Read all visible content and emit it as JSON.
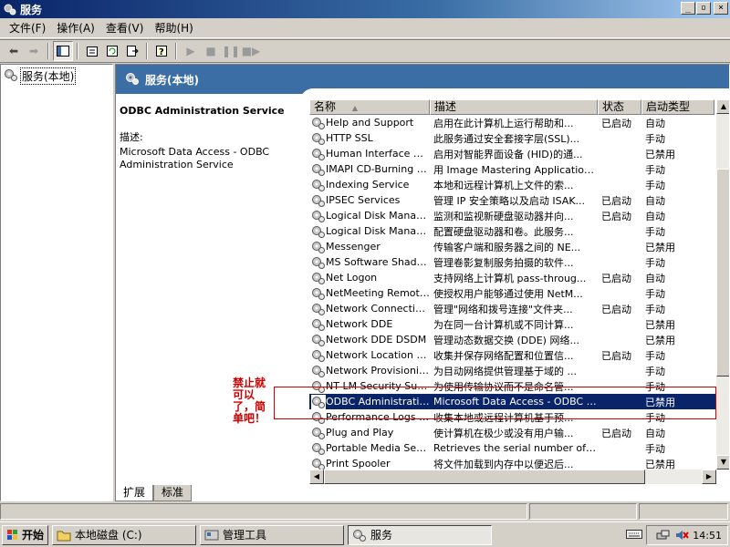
{
  "window": {
    "title": "服务"
  },
  "menu": [
    "文件(F)",
    "操作(A)",
    "查看(V)",
    "帮助(H)"
  ],
  "tree": {
    "root": "服务(本地)"
  },
  "pane": {
    "header": "服务(本地)",
    "selected_service": "ODBC Administration Service",
    "desc_label": "描述:",
    "desc_text": "Microsoft Data Access - ODBC Administration Service"
  },
  "table": {
    "columns": [
      "名称",
      "描述",
      "状态",
      "启动类型"
    ],
    "sort_arrow": "▲",
    "rows": [
      {
        "name": "Help and Support",
        "desc": "启用在此计算机上运行帮助和...",
        "status": "已启动",
        "type": "自动"
      },
      {
        "name": "HTTP SSL",
        "desc": "此服务通过安全套接字层(SSL)...",
        "status": "",
        "type": "手动"
      },
      {
        "name": "Human Interface D...",
        "desc": "启用对智能界面设备 (HID)的通...",
        "status": "",
        "type": "已禁用"
      },
      {
        "name": "IMAPI CD-Burning C...",
        "desc": "用 Image Mastering Applications ...",
        "status": "",
        "type": "手动"
      },
      {
        "name": "Indexing Service",
        "desc": "本地和远程计算机上文件的索...",
        "status": "",
        "type": "手动"
      },
      {
        "name": "IPSEC Services",
        "desc": "管理 IP 安全策略以及启动 ISAK...",
        "status": "已启动",
        "type": "自动"
      },
      {
        "name": "Logical Disk Manager",
        "desc": "监测和监视新硬盘驱动器并向...",
        "status": "已启动",
        "type": "自动"
      },
      {
        "name": "Logical Disk Manage...",
        "desc": "配置硬盘驱动器和卷。此服务...",
        "status": "",
        "type": "手动"
      },
      {
        "name": "Messenger",
        "desc": "传输客户端和服务器之间的 NE...",
        "status": "",
        "type": "已禁用"
      },
      {
        "name": "MS Software Shado...",
        "desc": "管理卷影复制服务拍摄的软件...",
        "status": "",
        "type": "手动"
      },
      {
        "name": "Net Logon",
        "desc": "支持网络上计算机 pass-throug...",
        "status": "已启动",
        "type": "自动"
      },
      {
        "name": "NetMeeting Remote...",
        "desc": "使授权用户能够通过使用 NetM...",
        "status": "",
        "type": "手动"
      },
      {
        "name": "Network Connections",
        "desc": "管理\"网络和拨号连接\"文件夹...",
        "status": "已启动",
        "type": "手动"
      },
      {
        "name": "Network DDE",
        "desc": "为在同一台计算机或不同计算...",
        "status": "",
        "type": "已禁用"
      },
      {
        "name": "Network DDE DSDM",
        "desc": "管理动态数据交换 (DDE) 网络...",
        "status": "",
        "type": "已禁用"
      },
      {
        "name": "Network Location A...",
        "desc": "收集并保存网络配置和位置信...",
        "status": "已启动",
        "type": "手动"
      },
      {
        "name": "Network Provisionin...",
        "desc": "为目动网络提供管理基于域的 ...",
        "status": "",
        "type": "手动"
      },
      {
        "name": "NT LM Security Sup...",
        "desc": "为使用传输协议而不是命名管...",
        "status": "",
        "type": "手动"
      },
      {
        "name": "ODBC Administratio...",
        "desc": "Microsoft Data Access - ODBC Ad...",
        "status": "",
        "type": "已禁用",
        "selected": true
      },
      {
        "name": "Performance Logs a...",
        "desc": "收集本地或远程计算机基于预...",
        "status": "",
        "type": "手动"
      },
      {
        "name": "Plug and Play",
        "desc": "使计算机在极少或没有用户输...",
        "status": "已启动",
        "type": "自动"
      },
      {
        "name": "Portable Media Seri...",
        "desc": "Retrieves the serial number of an...",
        "status": "",
        "type": "手动"
      },
      {
        "name": "Print Spooler",
        "desc": "将文件加载到内存中以便迟后...",
        "status": "",
        "type": "已禁用"
      }
    ]
  },
  "tabs": [
    "扩展",
    "标准"
  ],
  "annotation": {
    "text": "禁止就可以了，简单吧！",
    "color": "#cc0000"
  },
  "taskbar": {
    "start": "开始",
    "tasks": [
      "本地磁盘 (C:)",
      "管理工具",
      "服务"
    ],
    "clock": "14:51"
  },
  "colors": {
    "selection": "#0a246a",
    "header_blue": "#3a6ea5",
    "face": "#d4d0c8"
  }
}
